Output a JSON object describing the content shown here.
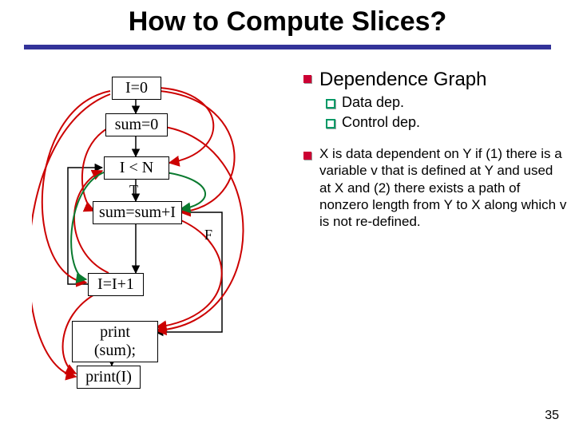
{
  "title": "How to Compute Slices?",
  "right": {
    "heading": "Dependence Graph",
    "sub1": "Data dep.",
    "sub2": "Control dep.",
    "body": "X is data dependent on Y if (1) there is a variable v that is defined at Y and used at X and (2) there exists a path of nonzero length from Y to X along which v is not re-defined."
  },
  "nodes": {
    "n1": "I=0",
    "n2": "sum=0",
    "n3": "I < N",
    "t_label": "T",
    "n4": "sum=sum+I",
    "f_label": "F",
    "n5": "I=I+1",
    "n6": "print (sum);",
    "n7": "print(I)"
  },
  "page": "35"
}
